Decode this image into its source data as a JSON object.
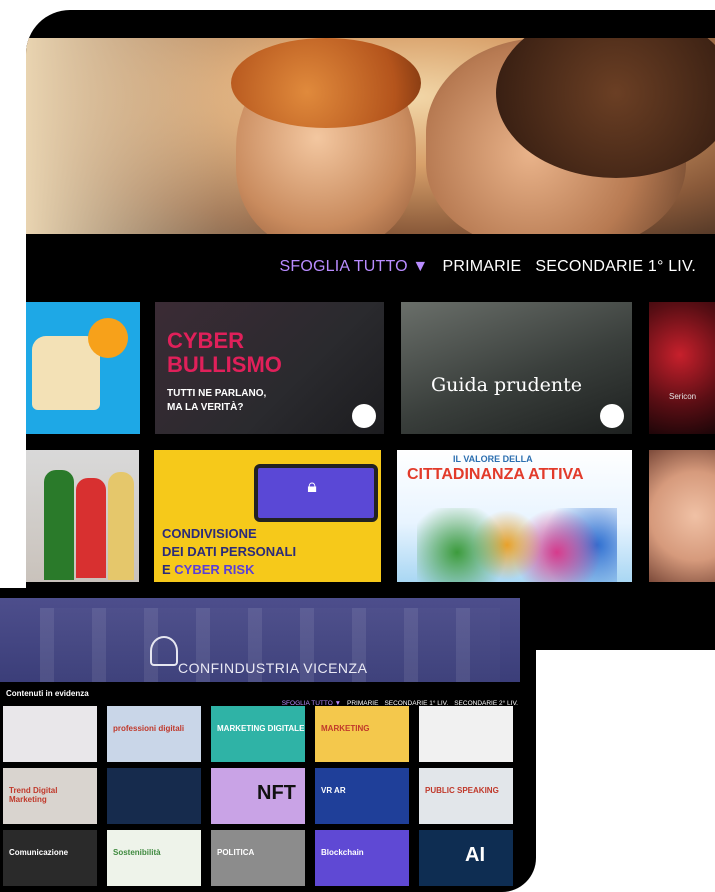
{
  "large_device": {
    "nav": {
      "items": [
        {
          "label": "SFOGLIA TUTTO ▼",
          "active": true
        },
        {
          "label": "PRIMARIE",
          "active": false
        },
        {
          "label": "SECONDARIE 1° LIV.",
          "active": false
        }
      ]
    },
    "tiles_row1": {
      "cyber": {
        "line1": "CYBER",
        "line2": "BULLISMO",
        "line3": "TUTTI NE PARLANO,",
        "line4": "MA LA VERITÀ?"
      },
      "guida": {
        "caption": "Guida prudente"
      },
      "dark": {
        "caption": "Sericon"
      }
    },
    "tiles_row2": {
      "privacy": {
        "line1": "CONDIVISIONE",
        "line2": "DEI DATI PERSONALI",
        "line3a": "E ",
        "line3b": "CYBER RISK"
      },
      "cittadinanza": {
        "line1": "IL VALORE DELLA",
        "line2": "CITTADINANZA ATTIVA"
      }
    }
  },
  "small_device": {
    "banner_name": "CONFINDUSTRIA VICENZA",
    "section_title": "Contenuti in evidenza",
    "nav": [
      {
        "label": "SFOGLIA TUTTO ▼",
        "active": true
      },
      {
        "label": "PRIMARIE",
        "active": false
      },
      {
        "label": "SECONDARIE 1° LIV.",
        "active": false
      },
      {
        "label": "SECONDARIE 2° LIV.",
        "active": false
      }
    ],
    "tiles": [
      {
        "caption": "",
        "bg": "#e9e7ea"
      },
      {
        "caption": "professioni digitali",
        "bg": "#c9d6e8"
      },
      {
        "caption": "MARKETING DIGITALE",
        "bg": "#2fb3a6"
      },
      {
        "caption": "MARKETING",
        "bg": "#f4c84c"
      },
      {
        "caption": "",
        "bg": "#f1f1f1"
      },
      {
        "caption": "Trend Digital Marketing",
        "bg": "#d9d4cf"
      },
      {
        "caption": "",
        "bg": "#162b4d"
      },
      {
        "caption": "NFT",
        "bg": "#c9a3e6"
      },
      {
        "caption": "VR AR",
        "bg": "#1f3f99"
      },
      {
        "caption": "PUBLIC SPEAKING",
        "bg": "#e2e6ea"
      },
      {
        "caption": "Comunicazione",
        "bg": "#2a2a2a"
      },
      {
        "caption": "Sostenibilità",
        "bg": "#eef3ea"
      },
      {
        "caption": "POLITICA",
        "bg": "#8c8c8c"
      },
      {
        "caption": "Blockchain",
        "bg": "#5f49d4"
      },
      {
        "caption": "AI",
        "bg": "#0e2d52"
      }
    ]
  },
  "colors": {
    "accent": "#b98cff",
    "background": "#000000"
  }
}
